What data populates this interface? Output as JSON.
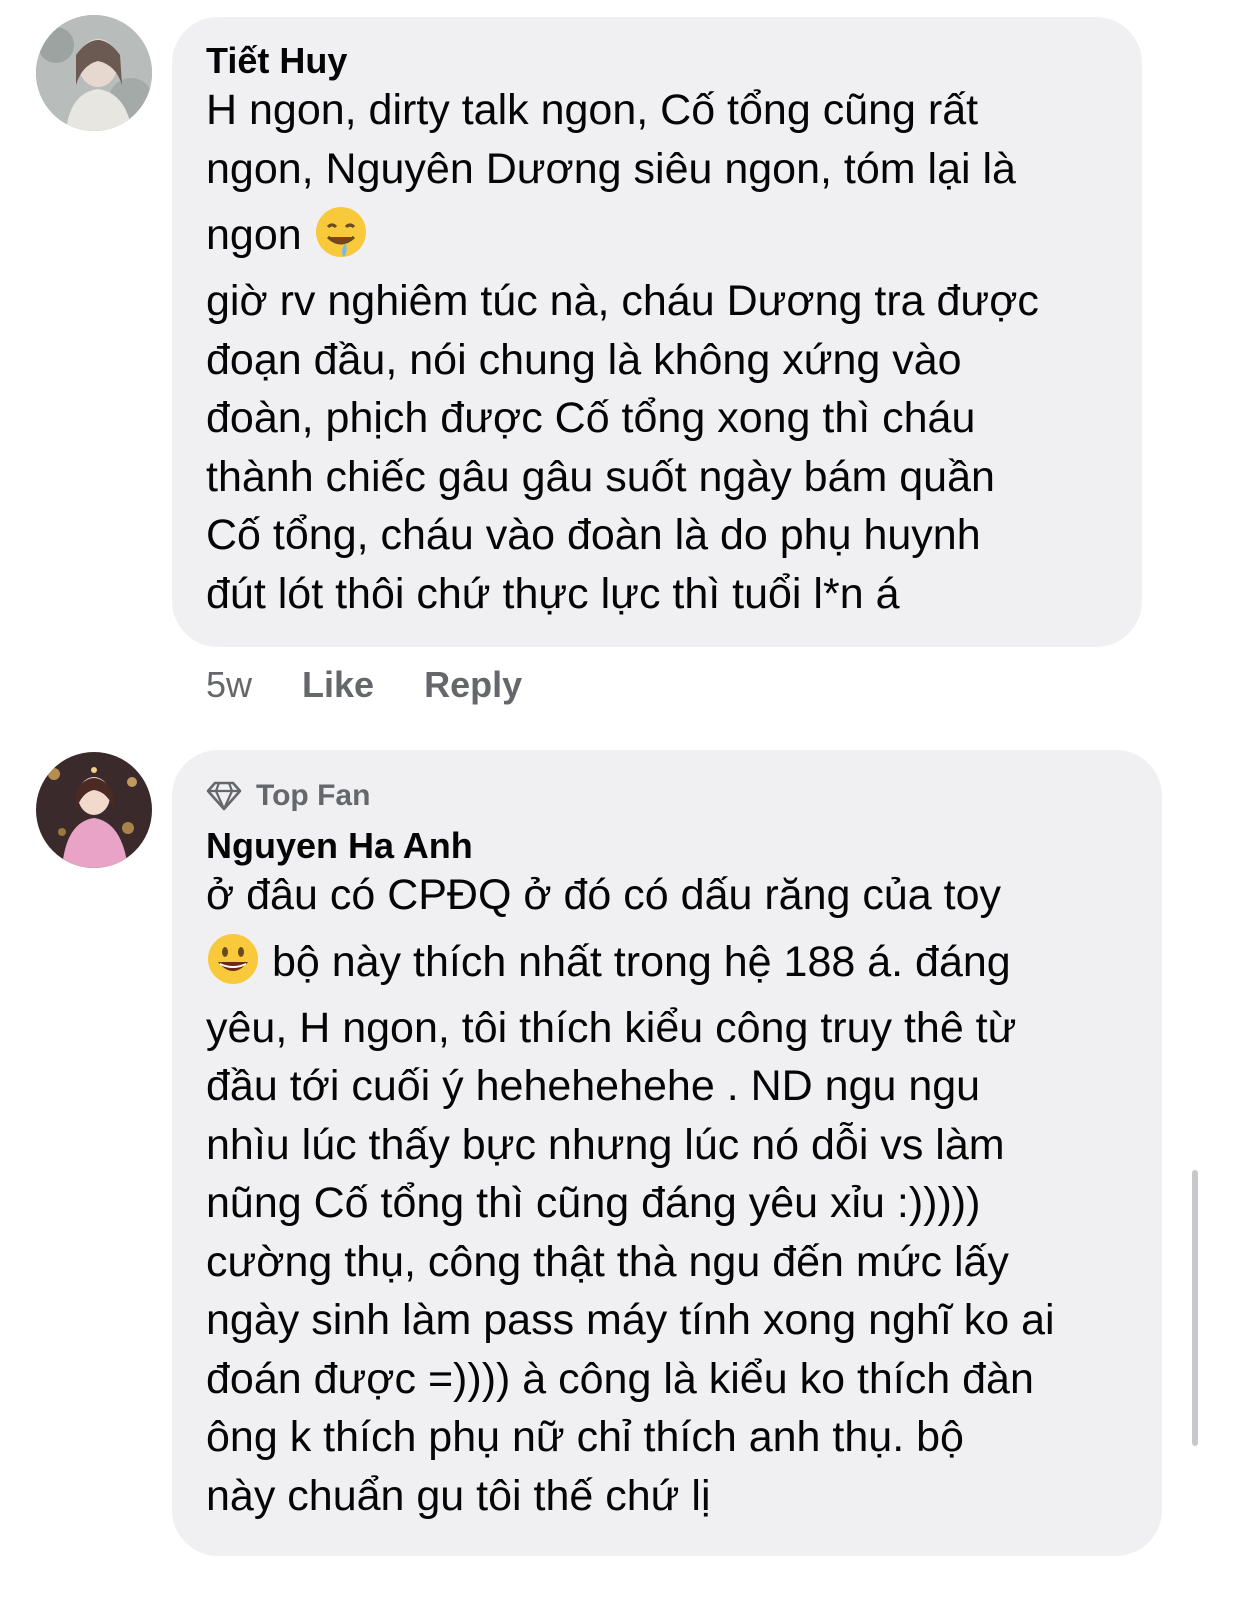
{
  "comments": [
    {
      "author": "Tiết Huy",
      "lines": [
        "H ngon, dirty talk ngon, Cố tổng cũng rất",
        "ngon, Nguyên Dương siêu ngon, tóm lại là",
        "ngon",
        "giờ rv nghiêm túc nà, cháu Dương tra được",
        "đoạn đầu, nói chung là không xứng vào",
        "đoàn, phịch được Cố tổng xong thì cháu",
        "thành chiếc gâu gâu suốt ngày bám quần",
        "Cố tổng, cháu vào đoàn là do phụ huynh",
        "đút lót thôi chứ thực lực thì tuổi l*n á"
      ],
      "emoji": "drooling-face-emoji",
      "timestamp": "5w",
      "like_label": "Like",
      "reply_label": "Reply"
    },
    {
      "badge": "Top Fan",
      "badge_icon": "diamond-icon",
      "author": "Nguyen Ha Anh",
      "lines": [
        "ở đâu có CPĐQ ở đó có dấu răng của toy",
        "bộ này thích nhất trong hệ 188 á. đáng",
        "yêu, H ngon, tôi thích kiểu công truy thê từ",
        "đầu tới cuối ý hehehehehe . ND ngu ngu",
        "nhìu lúc thấy bực nhưng lúc nó dỗi vs làm",
        "nũng Cố tổng thì cũng đáng yêu xỉu :)))))",
        "cường thụ, công thật thà ngu đến mức lấy",
        "ngày sinh làm pass máy tính xong nghĩ ko ai",
        "đoán được =)))) à công là kiểu ko thích đàn",
        "ông k thích phụ nữ chỉ thích anh thụ.  bộ",
        "này chuẩn gu tôi thế chứ lị"
      ],
      "emoji": "grinning-face-emoji"
    }
  ],
  "colors": {
    "bubble": "#f0f0f3",
    "text": "#050505",
    "secondary": "#65676b"
  }
}
